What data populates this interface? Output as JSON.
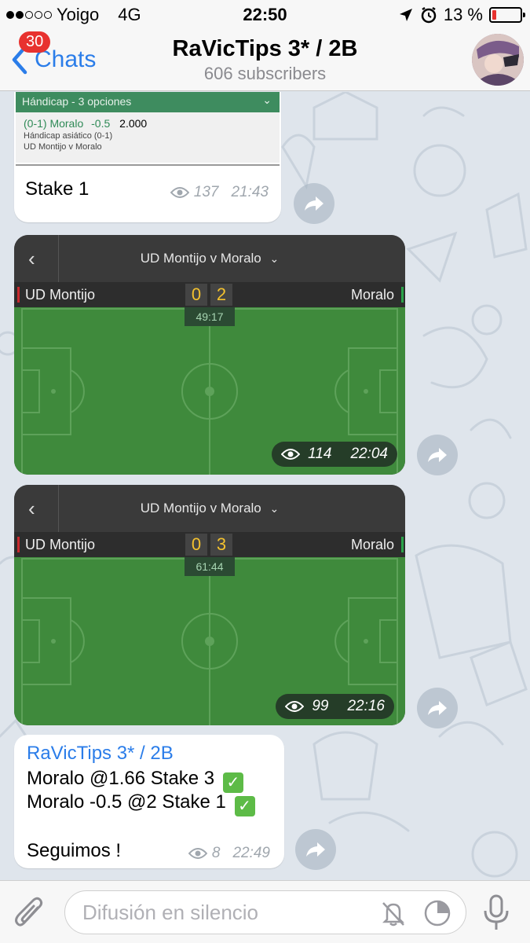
{
  "status": {
    "carrier": "Yoigo",
    "network": "4G",
    "time": "22:50",
    "battery": "13 %"
  },
  "header": {
    "back_label": "Chats",
    "unread_badge": "30",
    "title": "RaVicTips 3* / 2B",
    "subtitle": "606 subscribers"
  },
  "messages": {
    "bet_slip": {
      "market": "Hándicap - 3 opciones",
      "selection": "(0-1) Moralo",
      "line": "-0.5",
      "odds": "2.000",
      "market_detail": "Hándicap asiático (0-1)",
      "event": "UD Montijo v Moralo",
      "text": "Stake 1",
      "views": "137",
      "time": "21:43"
    },
    "match1": {
      "title": "UD Montijo v Moralo",
      "home": "UD Montijo",
      "away": "Moralo",
      "home_score": "0",
      "away_score": "2",
      "clock": "49:17",
      "views": "114",
      "time": "22:04"
    },
    "match2": {
      "title": "UD Montijo v Moralo",
      "home": "UD Montijo",
      "away": "Moralo",
      "home_score": "0",
      "away_score": "3",
      "clock": "61:44",
      "views": "99",
      "time": "22:16"
    },
    "text_post": {
      "author": "RaVicTips 3* / 2B",
      "line1": "Moralo @1.66 Stake 3",
      "line2": "Moralo -0.5 @2 Stake 1",
      "line3": "Seguimos !",
      "views": "8",
      "time": "22:49"
    }
  },
  "input": {
    "placeholder": "Difusión en silencio"
  },
  "colors": {
    "accent": "#2b7de9",
    "badge": "#e8322f",
    "pitch": "#3f8a3c",
    "check": "#5dbb47"
  }
}
